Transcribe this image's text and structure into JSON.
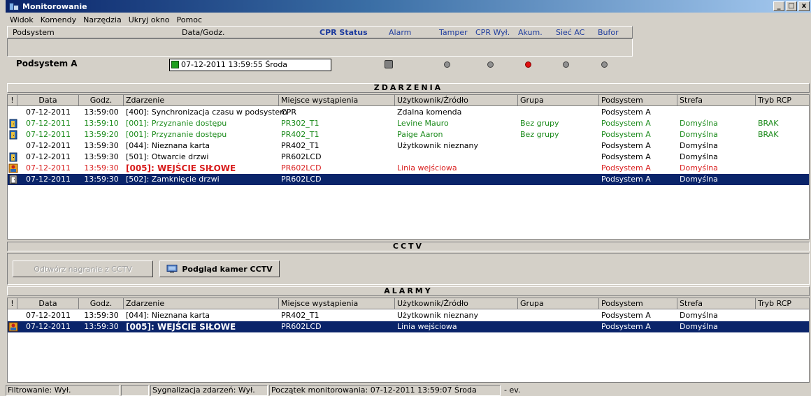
{
  "window": {
    "title": "Monitorowanie",
    "buttons": [
      "_",
      "□",
      "x"
    ]
  },
  "menu": [
    "Widok",
    "Komendy",
    "Narzędzia",
    "Ukryj okno",
    "Pomoc"
  ],
  "status_header": {
    "subsystem_label": "Podsystem",
    "datetime_label": "Data/Godz.",
    "cpr_status_label": "CPR Status",
    "alarm_label": "Alarm",
    "tamper_label": "Tamper",
    "cpr_off_label": "CPR Wył.",
    "akum_label": "Akum.",
    "ac_label": "Sieć AC",
    "buffer_label": "Bufor",
    "subsystem_value": "Podsystem A",
    "datetime_value": "07-12-2011  13:59:55  Środa",
    "colors": {
      "connected": "#1e9e1e",
      "akum_alarm": "#e01010",
      "dot": "#909090"
    }
  },
  "events": {
    "title": "ZDARZENIA",
    "columns": [
      "!",
      "Data",
      "Godz.",
      "Zdarzenie",
      "Miejsce wystąpienia",
      "Użytkownik/Źródło",
      "Grupa",
      "Podsystem",
      "Strefa",
      "Tryb RCP"
    ],
    "rows": [
      {
        "icon": "",
        "style": "normal",
        "date": "07-12-2011",
        "time": "13:59:00",
        "event": "[400]: Synchronizacja czasu w podsystemi",
        "place": "CPR",
        "user": "Zdalna komenda",
        "group": "",
        "subsystem": "Podsystem A",
        "zone": "",
        "rcp": ""
      },
      {
        "icon": "door-open-icon",
        "style": "green",
        "date": "07-12-2011",
        "time": "13:59:10",
        "event": "[001]: Przyznanie dostępu",
        "place": "PR302_T1",
        "user": "Levine Mauro",
        "group": "Bez grupy",
        "subsystem": "Podsystem A",
        "zone": "Domyślna",
        "rcp": "BRAK"
      },
      {
        "icon": "door-open-icon",
        "style": "green",
        "date": "07-12-2011",
        "time": "13:59:20",
        "event": "[001]: Przyznanie dostępu",
        "place": "PR402_T1",
        "user": "Paige Aaron",
        "group": "Bez grupy",
        "subsystem": "Podsystem A",
        "zone": "Domyślna",
        "rcp": "BRAK"
      },
      {
        "icon": "",
        "style": "normal",
        "date": "07-12-2011",
        "time": "13:59:30",
        "event": "[044]: Nieznana karta",
        "place": "PR402_T1",
        "user": "Użytkownik nieznany",
        "group": "",
        "subsystem": "Podsystem A",
        "zone": "Domyślna",
        "rcp": ""
      },
      {
        "icon": "door-open-icon",
        "style": "normal",
        "date": "07-12-2011",
        "time": "13:59:30",
        "event": "[501]: Otwarcie drzwi",
        "place": "PR602LCD",
        "user": "",
        "group": "",
        "subsystem": "Podsystem A",
        "zone": "Domyślna",
        "rcp": ""
      },
      {
        "icon": "forced-entry-icon",
        "style": "red",
        "date": "07-12-2011",
        "time": "13:59:30",
        "event": "[005]: WEJŚCIE SIŁOWE",
        "place": "PR602LCD",
        "user": "Linia wejściowa",
        "group": "",
        "subsystem": "Podsystem A",
        "zone": "Domyślna",
        "rcp": ""
      },
      {
        "icon": "door-closed-icon",
        "style": "sel",
        "date": "07-12-2011",
        "time": "13:59:30",
        "event": "[502]: Zamknięcie drzwi",
        "place": "PR602LCD",
        "user": "",
        "group": "",
        "subsystem": "Podsystem A",
        "zone": "Domyślna",
        "rcp": ""
      }
    ]
  },
  "cctv": {
    "title": "CCTV",
    "play_button": "Odtwórz nagranie z CCTV",
    "preview_button": "Podgląd kamer CCTV"
  },
  "alarms": {
    "title": "ALARMY",
    "columns": [
      "!",
      "Data",
      "Godz.",
      "Zdarzenie",
      "Miejsce wystąpienia",
      "Użytkownik/Źródło",
      "Grupa",
      "Podsystem",
      "Strefa",
      "Tryb RCP"
    ],
    "rows": [
      {
        "icon": "",
        "style": "normal",
        "date": "07-12-2011",
        "time": "13:59:30",
        "event": "[044]: Nieznana karta",
        "place": "PR402_T1",
        "user": "Użytkownik nieznany",
        "group": "",
        "subsystem": "Podsystem A",
        "zone": "Domyślna",
        "rcp": ""
      },
      {
        "icon": "forced-entry-icon",
        "style": "sel",
        "date": "07-12-2011",
        "time": "13:59:30",
        "event": "[005]: WEJŚCIE SIŁOWE",
        "place": "PR602LCD",
        "user": "Linia wejściowa",
        "group": "",
        "subsystem": "Podsystem A",
        "zone": "Domyślna",
        "rcp": ""
      }
    ]
  },
  "statusbar": {
    "filter": "Filtrowanie: Wył.",
    "empty": "",
    "signaling": "Sygnalizacja zdarzeń: Wył.",
    "monitor_start": "Początek monitorowania: 07-12-2011  13:59:07  Środa",
    "ev": "- ev."
  }
}
